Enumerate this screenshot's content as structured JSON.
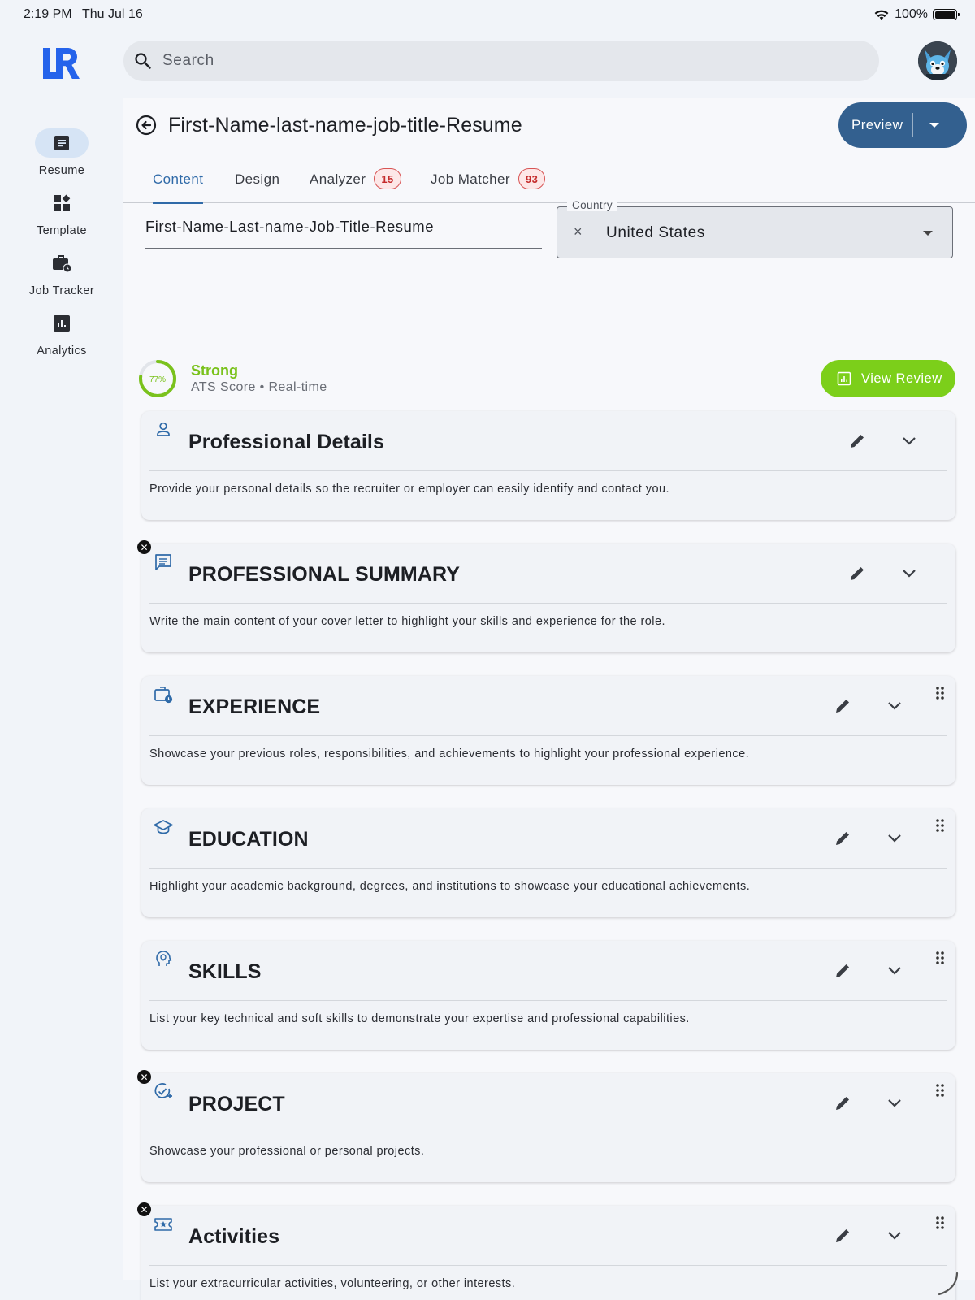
{
  "status_bar": {
    "time": "2:19 PM",
    "date": "Thu Jul 16",
    "battery": "100%"
  },
  "sidebar": {
    "items": [
      {
        "label": "Resume",
        "icon": "resume-icon",
        "active": true
      },
      {
        "label": "Template",
        "icon": "template-icon",
        "active": false
      },
      {
        "label": "Job Tracker",
        "icon": "job-tracker-icon",
        "active": false
      },
      {
        "label": "Analytics",
        "icon": "analytics-icon",
        "active": false
      }
    ]
  },
  "search": {
    "placeholder": "Search"
  },
  "header": {
    "title": "First-Name-last-name-job-title-Resume",
    "preview_label": "Preview"
  },
  "tabs": [
    {
      "label": "Content",
      "badge": ""
    },
    {
      "label": "Design",
      "badge": ""
    },
    {
      "label": "Analyzer",
      "badge": "15"
    },
    {
      "label": "Job Matcher",
      "badge": "93"
    }
  ],
  "form": {
    "filename": "First-Name-Last-name-Job-Title-Resume",
    "country_label": "Country",
    "country_value": "United States"
  },
  "ats": {
    "percent_label": "77%",
    "percent": 77,
    "status": "Strong",
    "subtitle": "ATS Score • Real-time",
    "view_review_label": "View Review"
  },
  "colors": {
    "primary": "#33608f",
    "accent_green": "#7ccf1a",
    "tab_active": "#2f6aa8",
    "badge_red": "#c42b2b"
  },
  "sections": [
    {
      "title": "Professional Details",
      "description": "Provide your personal details so the recruiter or employer can easily identify and contact you.",
      "icon": "person-icon",
      "removable": false,
      "draggable": false
    },
    {
      "title": "PROFESSIONAL SUMMARY",
      "description": "Write the main content of your cover letter to highlight your skills and experience for the role.",
      "icon": "message-icon",
      "removable": true,
      "draggable": false
    },
    {
      "title": "EXPERIENCE",
      "description": "Showcase your previous roles, responsibilities, and achievements to highlight your professional experience.",
      "icon": "briefcase-clock-icon",
      "removable": false,
      "draggable": true
    },
    {
      "title": "EDUCATION",
      "description": "Highlight your academic background, degrees, and institutions to showcase your educational achievements.",
      "icon": "graduation-cap-icon",
      "removable": false,
      "draggable": true
    },
    {
      "title": "SKILLS",
      "description": "List your key technical and soft skills to demonstrate your expertise and professional capabilities.",
      "icon": "head-lightbulb-icon",
      "removable": false,
      "draggable": true
    },
    {
      "title": "PROJECT",
      "description": "Showcase your professional or personal projects.",
      "icon": "check-add-icon",
      "removable": true,
      "draggable": true
    },
    {
      "title": "Activities",
      "description": "List your extracurricular activities, volunteering, or other interests.",
      "icon": "ticket-star-icon",
      "removable": true,
      "draggable": true
    }
  ]
}
